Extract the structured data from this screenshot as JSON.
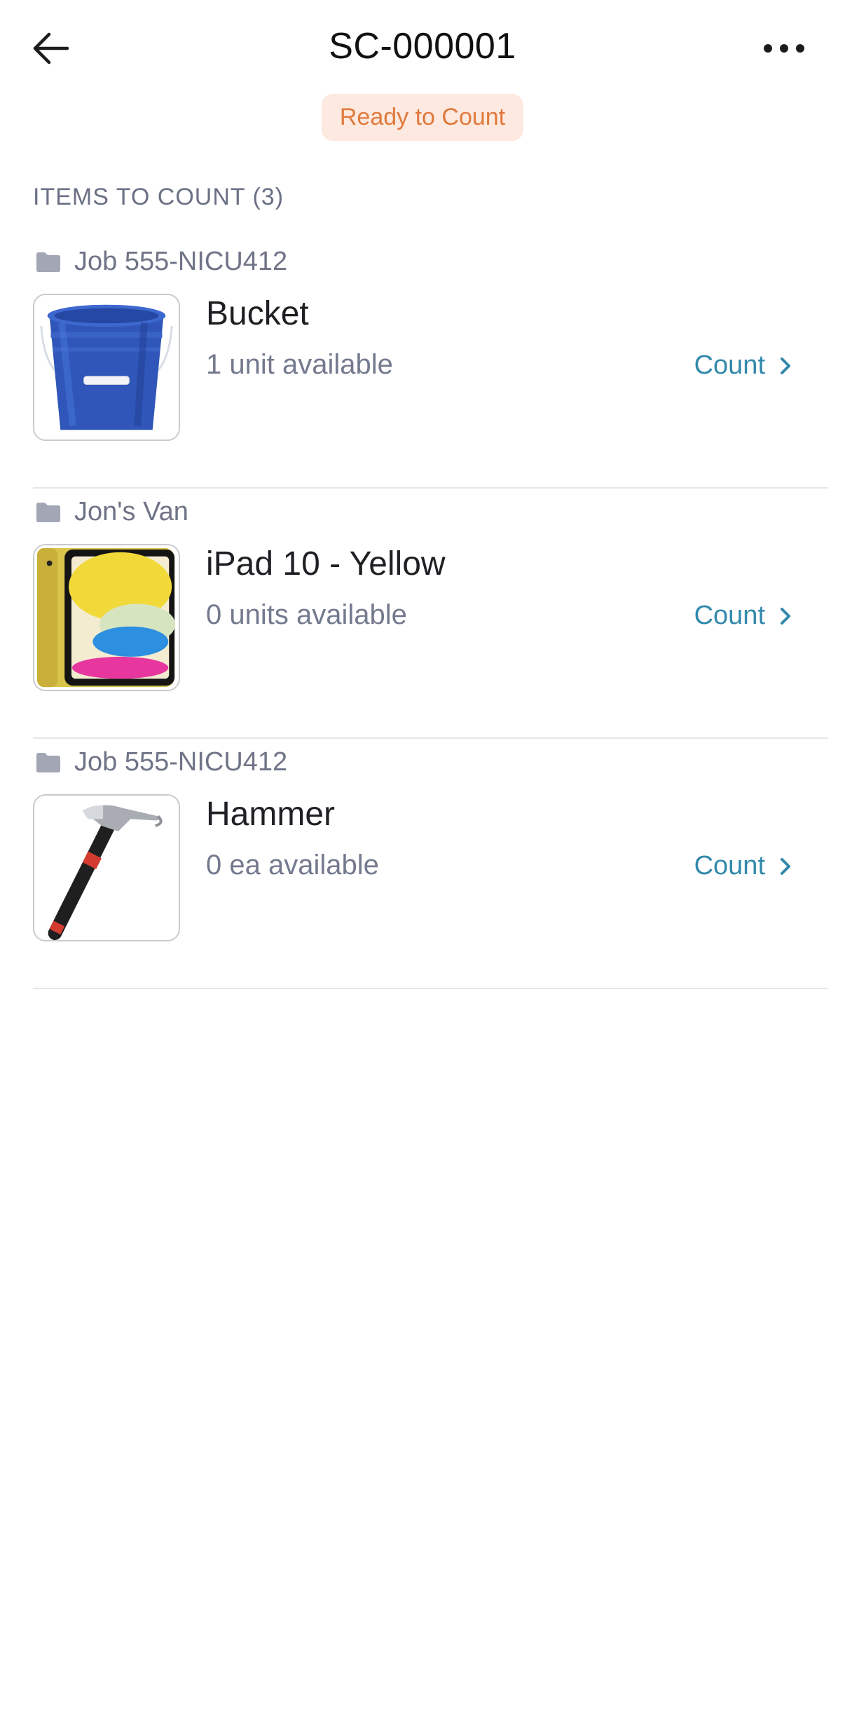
{
  "header": {
    "title": "SC-000001",
    "status_badge": "Ready to Count",
    "back_icon": "back-arrow-icon",
    "more_icon": "more-dots-icon"
  },
  "section": {
    "title": "ITEMS TO COUNT (3)"
  },
  "colors": {
    "badge_bg": "#fde9df",
    "badge_text": "#e07a3d",
    "accent": "#3289ab",
    "muted_text": "#747a8e"
  },
  "items": [
    {
      "location": "Job 555-NICU412",
      "name": "Bucket",
      "availability": "1 unit available",
      "action": "Count",
      "thumbnail": "blue-bucket-image"
    },
    {
      "location": "Jon's Van",
      "name": "iPad 10 - Yellow",
      "availability": "0 units available",
      "action": "Count",
      "thumbnail": "yellow-ipad-image"
    },
    {
      "location": "Job 555-NICU412",
      "name": "Hammer",
      "availability": "0 ea available",
      "action": "Count",
      "thumbnail": "claw-hammer-image"
    }
  ]
}
